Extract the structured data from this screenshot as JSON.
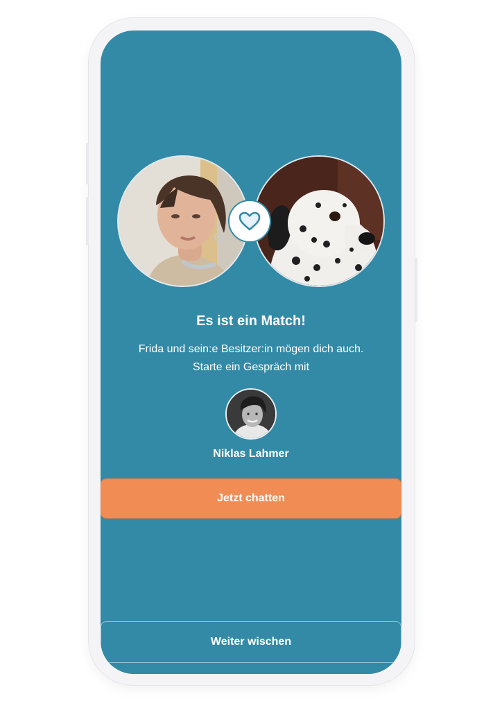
{
  "match": {
    "title": "Es ist ein Match!",
    "message": "Frida und sein:e Besitzer:in mögen dich auch. Starte ein Gespräch mit",
    "owner_name": "Niklas Lahmer",
    "left_photo_icon": "woman-portrait-photo",
    "right_photo_icon": "dalmatian-dog-photo",
    "badge_icon": "heart-icon"
  },
  "actions": {
    "chat_label": "Jetzt chatten",
    "swipe_label": "Weiter wischen"
  },
  "colors": {
    "background": "#338aa6",
    "primary_button": "#f18c55",
    "text": "#ffffff",
    "heart": "#338aa6"
  }
}
